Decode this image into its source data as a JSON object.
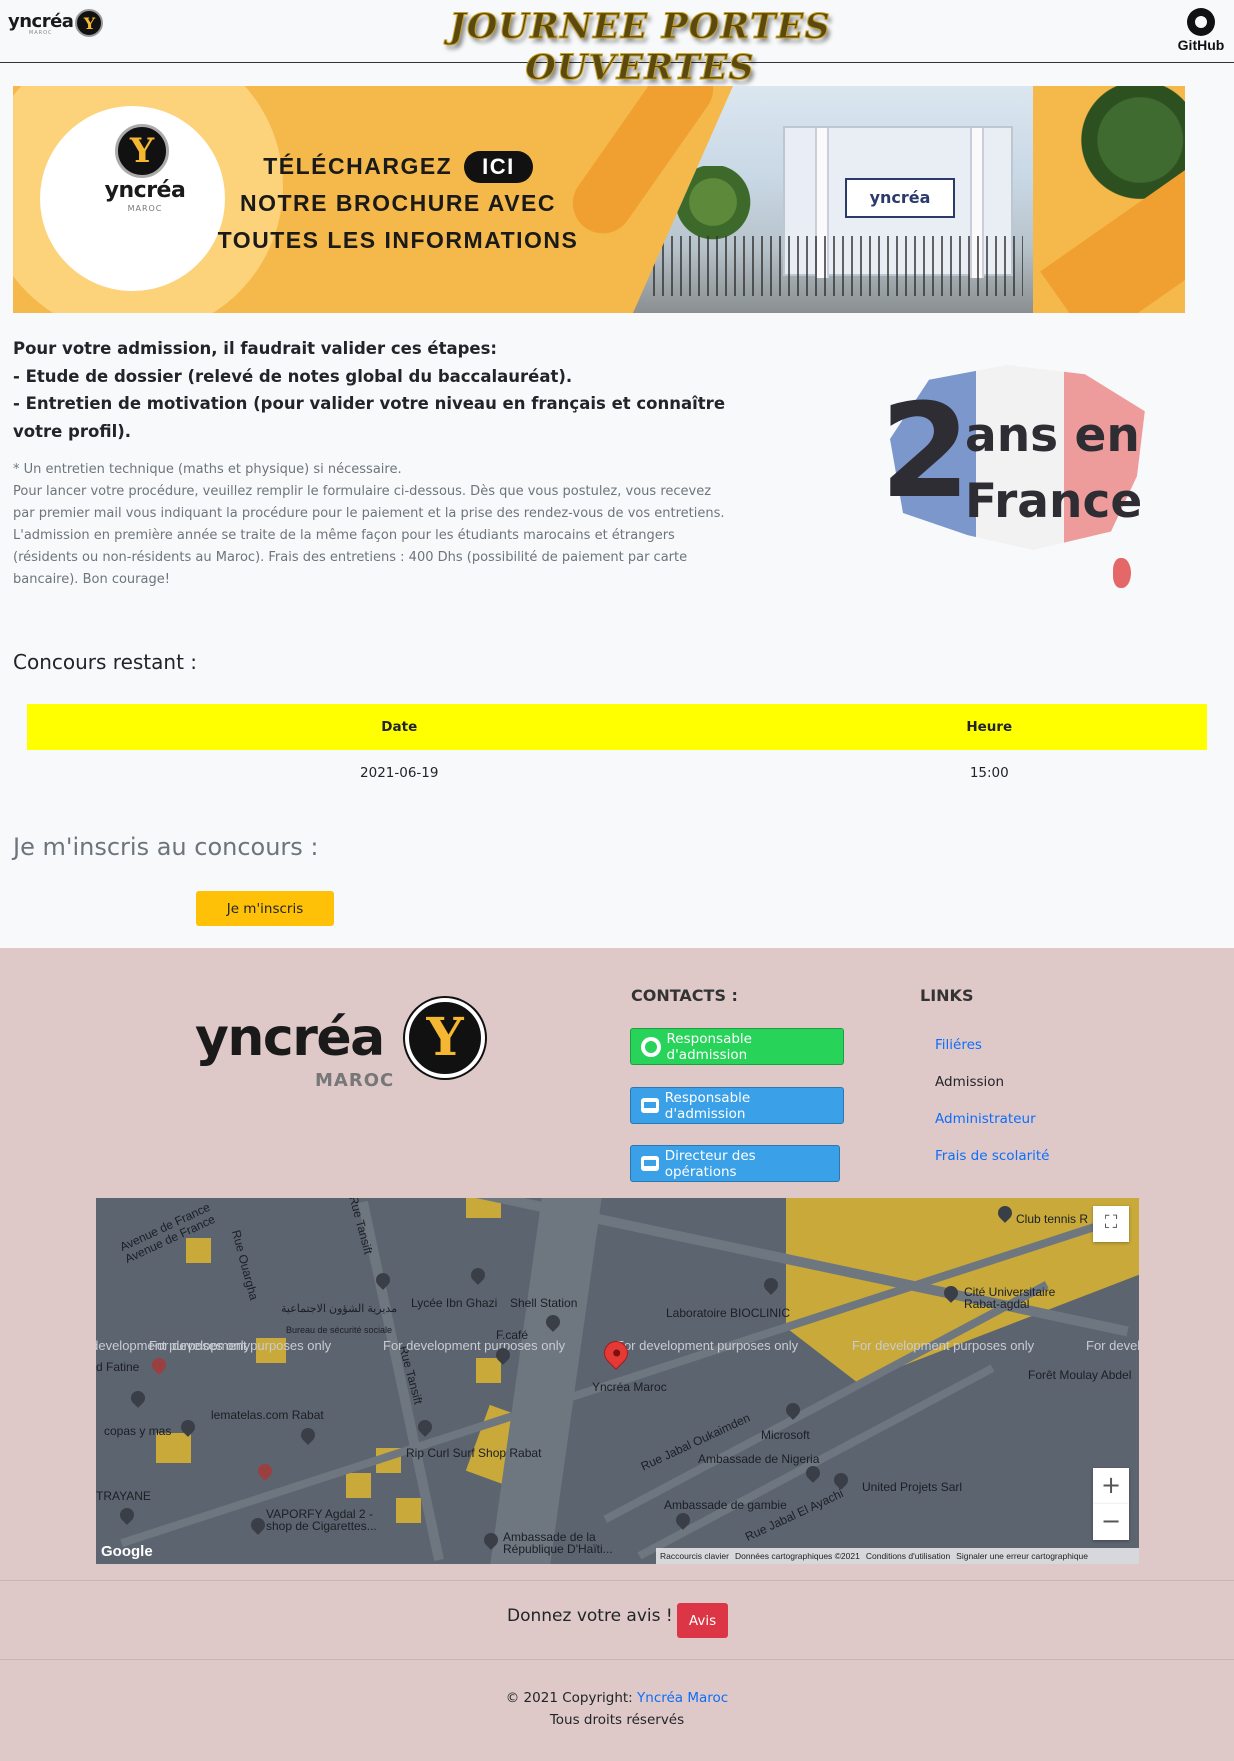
{
  "navbar": {
    "logo_word": "yncréa",
    "logo_sub": "MAROC",
    "logo_letter": "Y",
    "title": "JOURNEE PORTES OUVERTES",
    "github_label": "GitHub"
  },
  "banner": {
    "logo_word": "yncréa",
    "logo_sub": "MAROC",
    "logo_letter": "Y",
    "line1": "TÉLÉCHARGEZ",
    "ici": "ICI",
    "line2": "NOTRE BROCHURE AVEC",
    "line3": "TOUTES LES INFORMATIONS",
    "building_sign": "yncréa"
  },
  "admission": {
    "heading": "Pour votre admission, il faudrait valider ces étapes:",
    "step1": "- Etude de dossier (relevé de notes global du baccalauréat).",
    "step2": "- Entretien de motivation (pour valider votre niveau en français et connaître votre profil).",
    "note1": "* Un entretien technique (maths et physique) si nécessaire.",
    "note2": "Pour lancer votre procédure, veuillez remplir le formulaire ci-dessous. Dès que vous postulez, vous recevez par premier mail vous indiquant la procédure pour le paiement et la prise des rendez-vous de vos entretiens.",
    "note3": "L'admission en première année se traite de la même façon pour les étudiants marocains et étrangers (résidents ou non-résidents au Maroc). Frais des entretiens : 400 Dhs (possibilité de paiement par carte bancaire). Bon courage!"
  },
  "france_graphic": {
    "number": "2",
    "line1": "ans en",
    "line2": "France"
  },
  "concours": {
    "title": "Concours restant :",
    "columns": [
      "Date",
      "Heure"
    ],
    "rows": [
      [
        "2021-06-19",
        "15:00"
      ]
    ]
  },
  "inscription": {
    "title": "Je m'inscris au concours :",
    "button": "Je m'inscris"
  },
  "footer": {
    "logo_word": "yncréa",
    "logo_sub": "MAROC",
    "logo_letter": "Y",
    "contacts_title": "CONTACTS :",
    "contacts": [
      {
        "label": "Responsable d'admission",
        "icon": "whatsapp-icon"
      },
      {
        "label": "Responsable d'admission",
        "icon": "mail-icon"
      },
      {
        "label": "Directeur des opérations",
        "icon": "mail-icon"
      }
    ],
    "links_title": "LINKS",
    "links": [
      "Filiéres",
      "Admission",
      "Administrateur",
      "Frais de scolarité"
    ],
    "map": {
      "dev_text": "For development purposes only",
      "pin_label": "Yncréa Maroc",
      "labels": [
        "Avenue de France",
        "Avenue de France",
        "Rue Ouargha",
        "Rue Tansift",
        "Lycée Ibn Ghazi",
        "Shell Station",
        "Laboratoire BIOCLINIC",
        "Club tennis R",
        "Cité Universitaire Rabat-agdal",
        "مديرية الشؤون الاجتماعية",
        "Bureau de sécurité sociale",
        "F.café",
        "Forêt Moulay Abdel",
        "d Fatine",
        "lematelas.com Rabat",
        "copas y mas",
        "Rip Curl Surf Shop Rabat",
        "Microsoft",
        "Ambassade de Nigeria",
        "United Projets Sarl",
        "Rue Jabal Oukaimden",
        "Ambassade de gambie",
        "Rue Jabal El Ayachi",
        "TRAYANE",
        "VAPORFY Agdal 2 - shop de Cigarettes...",
        "Ambassade de la République D'Haïti...",
        "Rue Tansift"
      ],
      "google": "Google",
      "attribution": [
        "Raccourcis clavier",
        "Données cartographiques ©2021",
        "Conditions d'utilisation",
        "Signaler une erreur cartographique"
      ],
      "zoom_in": "+",
      "zoom_out": "−"
    },
    "avis_text": "Donnez votre avis !",
    "avis_button": "Avis",
    "copyright_prefix": "© 2021 Copyright: ",
    "copyright_link": "Yncréa Maroc",
    "rights": "Tous droits réservés"
  }
}
